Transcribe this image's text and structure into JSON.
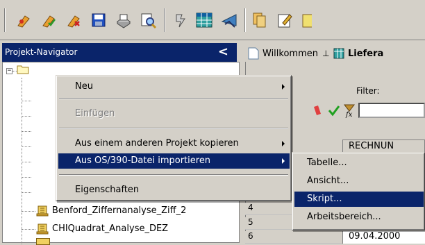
{
  "toolbar": {
    "icons": [
      "new-project-icon",
      "open-project-icon",
      "properties-icon",
      "save-icon",
      "print-icon",
      "find-icon",
      "refresh-icon",
      "table-icon",
      "chart-icon",
      "copy-icon",
      "edit-icon",
      "note-icon"
    ]
  },
  "navigator": {
    "title": "Projekt-Navigator",
    "collapse": "<",
    "root_toggle": "⊟",
    "items": [
      {
        "label": "Benford_Ziffernanalyse_Ziff_2",
        "row": "4"
      },
      {
        "label": "CHIQuadrat_Analyse_DEZ",
        "row": "5"
      }
    ]
  },
  "tabs": [
    {
      "label": "Willkommen"
    },
    {
      "label": "Liefera"
    }
  ],
  "filter": {
    "label": "Filter:"
  },
  "grid": {
    "column_header": "RECHNUN",
    "last_row": {
      "row": "6",
      "value": "09.04.2000"
    }
  },
  "context_menu": {
    "items": [
      {
        "label": "Neu",
        "submenu": true,
        "enabled": true
      },
      {
        "label": "Einfügen",
        "submenu": false,
        "enabled": false
      },
      {
        "label": "Aus einem anderen Projekt kopieren",
        "submenu": true,
        "enabled": true
      },
      {
        "label": "Aus OS/390-Datei importieren",
        "submenu": true,
        "enabled": true,
        "selected": true
      },
      {
        "label": "Eigenschaften",
        "submenu": false,
        "enabled": true
      }
    ]
  },
  "submenu": {
    "items": [
      {
        "label": "Tabelle..."
      },
      {
        "label": "Ansicht..."
      },
      {
        "label": "Skript...",
        "selected": true
      },
      {
        "label": "Arbeitsbereich..."
      }
    ]
  },
  "colors": {
    "selection": "#0a246a",
    "chrome": "#d4d0c8"
  }
}
